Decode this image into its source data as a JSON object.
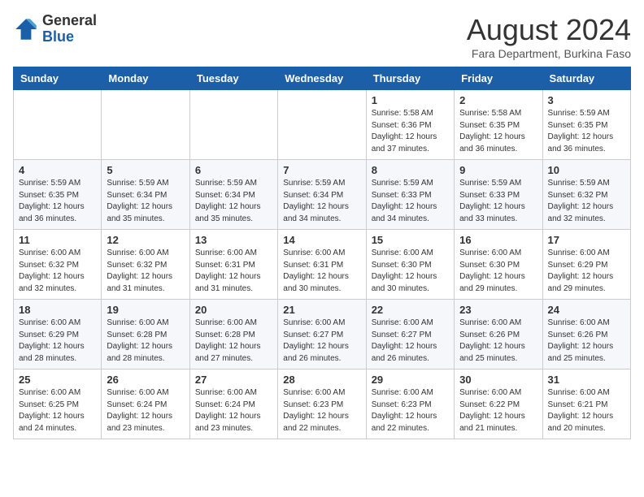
{
  "header": {
    "logo_general": "General",
    "logo_blue": "Blue",
    "month_year": "August 2024",
    "location": "Fara Department, Burkina Faso"
  },
  "days_of_week": [
    "Sunday",
    "Monday",
    "Tuesday",
    "Wednesday",
    "Thursday",
    "Friday",
    "Saturday"
  ],
  "weeks": [
    [
      {
        "day": "",
        "info": ""
      },
      {
        "day": "",
        "info": ""
      },
      {
        "day": "",
        "info": ""
      },
      {
        "day": "",
        "info": ""
      },
      {
        "day": "1",
        "info": "Sunrise: 5:58 AM\nSunset: 6:36 PM\nDaylight: 12 hours\nand 37 minutes."
      },
      {
        "day": "2",
        "info": "Sunrise: 5:58 AM\nSunset: 6:35 PM\nDaylight: 12 hours\nand 36 minutes."
      },
      {
        "day": "3",
        "info": "Sunrise: 5:59 AM\nSunset: 6:35 PM\nDaylight: 12 hours\nand 36 minutes."
      }
    ],
    [
      {
        "day": "4",
        "info": "Sunrise: 5:59 AM\nSunset: 6:35 PM\nDaylight: 12 hours\nand 36 minutes."
      },
      {
        "day": "5",
        "info": "Sunrise: 5:59 AM\nSunset: 6:34 PM\nDaylight: 12 hours\nand 35 minutes."
      },
      {
        "day": "6",
        "info": "Sunrise: 5:59 AM\nSunset: 6:34 PM\nDaylight: 12 hours\nand 35 minutes."
      },
      {
        "day": "7",
        "info": "Sunrise: 5:59 AM\nSunset: 6:34 PM\nDaylight: 12 hours\nand 34 minutes."
      },
      {
        "day": "8",
        "info": "Sunrise: 5:59 AM\nSunset: 6:33 PM\nDaylight: 12 hours\nand 34 minutes."
      },
      {
        "day": "9",
        "info": "Sunrise: 5:59 AM\nSunset: 6:33 PM\nDaylight: 12 hours\nand 33 minutes."
      },
      {
        "day": "10",
        "info": "Sunrise: 5:59 AM\nSunset: 6:32 PM\nDaylight: 12 hours\nand 32 minutes."
      }
    ],
    [
      {
        "day": "11",
        "info": "Sunrise: 6:00 AM\nSunset: 6:32 PM\nDaylight: 12 hours\nand 32 minutes."
      },
      {
        "day": "12",
        "info": "Sunrise: 6:00 AM\nSunset: 6:32 PM\nDaylight: 12 hours\nand 31 minutes."
      },
      {
        "day": "13",
        "info": "Sunrise: 6:00 AM\nSunset: 6:31 PM\nDaylight: 12 hours\nand 31 minutes."
      },
      {
        "day": "14",
        "info": "Sunrise: 6:00 AM\nSunset: 6:31 PM\nDaylight: 12 hours\nand 30 minutes."
      },
      {
        "day": "15",
        "info": "Sunrise: 6:00 AM\nSunset: 6:30 PM\nDaylight: 12 hours\nand 30 minutes."
      },
      {
        "day": "16",
        "info": "Sunrise: 6:00 AM\nSunset: 6:30 PM\nDaylight: 12 hours\nand 29 minutes."
      },
      {
        "day": "17",
        "info": "Sunrise: 6:00 AM\nSunset: 6:29 PM\nDaylight: 12 hours\nand 29 minutes."
      }
    ],
    [
      {
        "day": "18",
        "info": "Sunrise: 6:00 AM\nSunset: 6:29 PM\nDaylight: 12 hours\nand 28 minutes."
      },
      {
        "day": "19",
        "info": "Sunrise: 6:00 AM\nSunset: 6:28 PM\nDaylight: 12 hours\nand 28 minutes."
      },
      {
        "day": "20",
        "info": "Sunrise: 6:00 AM\nSunset: 6:28 PM\nDaylight: 12 hours\nand 27 minutes."
      },
      {
        "day": "21",
        "info": "Sunrise: 6:00 AM\nSunset: 6:27 PM\nDaylight: 12 hours\nand 26 minutes."
      },
      {
        "day": "22",
        "info": "Sunrise: 6:00 AM\nSunset: 6:27 PM\nDaylight: 12 hours\nand 26 minutes."
      },
      {
        "day": "23",
        "info": "Sunrise: 6:00 AM\nSunset: 6:26 PM\nDaylight: 12 hours\nand 25 minutes."
      },
      {
        "day": "24",
        "info": "Sunrise: 6:00 AM\nSunset: 6:26 PM\nDaylight: 12 hours\nand 25 minutes."
      }
    ],
    [
      {
        "day": "25",
        "info": "Sunrise: 6:00 AM\nSunset: 6:25 PM\nDaylight: 12 hours\nand 24 minutes."
      },
      {
        "day": "26",
        "info": "Sunrise: 6:00 AM\nSunset: 6:24 PM\nDaylight: 12 hours\nand 23 minutes."
      },
      {
        "day": "27",
        "info": "Sunrise: 6:00 AM\nSunset: 6:24 PM\nDaylight: 12 hours\nand 23 minutes."
      },
      {
        "day": "28",
        "info": "Sunrise: 6:00 AM\nSunset: 6:23 PM\nDaylight: 12 hours\nand 22 minutes."
      },
      {
        "day": "29",
        "info": "Sunrise: 6:00 AM\nSunset: 6:23 PM\nDaylight: 12 hours\nand 22 minutes."
      },
      {
        "day": "30",
        "info": "Sunrise: 6:00 AM\nSunset: 6:22 PM\nDaylight: 12 hours\nand 21 minutes."
      },
      {
        "day": "31",
        "info": "Sunrise: 6:00 AM\nSunset: 6:21 PM\nDaylight: 12 hours\nand 20 minutes."
      }
    ]
  ]
}
